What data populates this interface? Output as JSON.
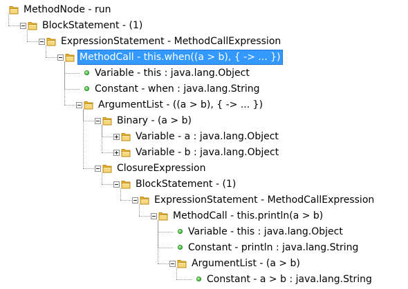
{
  "tree": {
    "items": [
      {
        "label": "MethodNode - run",
        "icon": "folder-icon",
        "toggle": "none",
        "depth": 0
      },
      {
        "label": "BlockStatement - (1)",
        "icon": "folder-icon",
        "toggle": "expanded",
        "depth": 1
      },
      {
        "label": "ExpressionStatement - MethodCallExpression",
        "icon": "folder-icon",
        "toggle": "expanded",
        "depth": 2
      },
      {
        "label": "MethodCall - this.when((a > b), { -> ... })",
        "icon": "folder-icon",
        "toggle": "expanded",
        "depth": 3,
        "selected": true
      },
      {
        "label": "Variable - this : java.lang.Object",
        "icon": "green-dot-icon",
        "toggle": "none",
        "depth": 4
      },
      {
        "label": "Constant - when : java.lang.String",
        "icon": "green-dot-icon",
        "toggle": "none",
        "depth": 4
      },
      {
        "label": "ArgumentList - ((a > b), { -> ... })",
        "icon": "folder-icon",
        "toggle": "expanded",
        "depth": 4
      },
      {
        "label": "Binary - (a > b)",
        "icon": "folder-icon",
        "toggle": "expanded",
        "depth": 5
      },
      {
        "label": "Variable - a : java.lang.Object",
        "icon": "folder-icon",
        "toggle": "collapsed",
        "depth": 6
      },
      {
        "label": "Variable - b : java.lang.Object",
        "icon": "folder-icon",
        "toggle": "collapsed",
        "depth": 6
      },
      {
        "label": "ClosureExpression",
        "icon": "folder-icon",
        "toggle": "expanded",
        "depth": 5
      },
      {
        "label": "BlockStatement - (1)",
        "icon": "folder-icon",
        "toggle": "expanded",
        "depth": 6
      },
      {
        "label": "ExpressionStatement - MethodCallExpression",
        "icon": "folder-icon",
        "toggle": "expanded",
        "depth": 7
      },
      {
        "label": "MethodCall - this.println(a > b)",
        "icon": "folder-icon",
        "toggle": "expanded",
        "depth": 8
      },
      {
        "label": "Variable - this : java.lang.Object",
        "icon": "green-dot-icon",
        "toggle": "none",
        "depth": 9
      },
      {
        "label": "Constant - println : java.lang.String",
        "icon": "green-dot-icon",
        "toggle": "none",
        "depth": 9
      },
      {
        "label": "ArgumentList - (a > b)",
        "icon": "folder-icon",
        "toggle": "expanded",
        "depth": 9
      },
      {
        "label": "Constant - a > b : java.lang.String",
        "icon": "green-dot-icon",
        "toggle": "none",
        "depth": 10
      }
    ]
  }
}
